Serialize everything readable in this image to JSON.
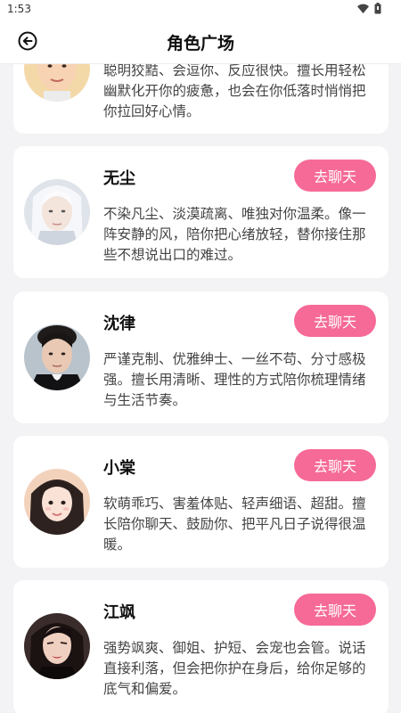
{
  "status_bar": {
    "time": "1:53"
  },
  "header": {
    "title": "角色广场"
  },
  "cards": [
    {
      "name": "",
      "button_label": "",
      "description": "聪明狡黠、会逗你、反应很快。擅长用轻松幽默化开你的疲惫，也会在你低落时悄悄把你拉回好心情。"
    },
    {
      "name": "无尘",
      "button_label": "去聊天",
      "description": "不染凡尘、淡漠疏离、唯独对你温柔。像一阵安静的风，陪你把心绪放轻，替你接住那些不想说出口的难过。"
    },
    {
      "name": "沈律",
      "button_label": "去聊天",
      "description": "严谨克制、优雅绅士、一丝不苟、分寸感极强。擅长用清晰、理性的方式陪你梳理情绪与生活节奏。"
    },
    {
      "name": "小棠",
      "button_label": "去聊天",
      "description": "软萌乖巧、害羞体贴、轻声细语、超甜。擅长陪你聊天、鼓励你、把平凡日子说得很温暖。"
    },
    {
      "name": "江飒",
      "button_label": "去聊天",
      "description": "强势飒爽、御姐、护短、会宠也会管。说话直接利落，但会把你护在身后，给你足够的底气和偏爱。"
    }
  ]
}
